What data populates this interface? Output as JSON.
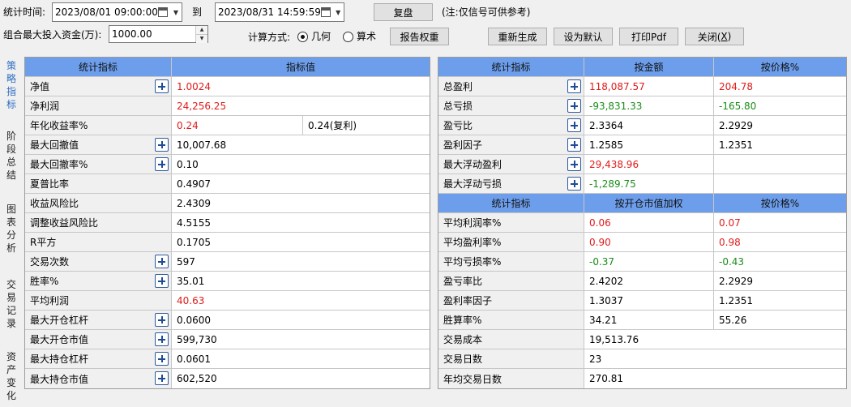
{
  "toolbar": {
    "stat_time_label": "统计时间:",
    "start_datetime": "2023/08/01 09:00:00",
    "to_label": "到",
    "end_datetime": "2023/08/31 14:59:59",
    "replay_button": "复盘",
    "note": "(注:仅信号可供参考)",
    "max_capital_label": "组合最大投入资金(万):",
    "max_capital_value": "1000.00",
    "calc_method_label": "计算方式:",
    "geometric_label": "几何",
    "arithmetic_label": "算术",
    "calc_method_selected": "几何",
    "report_weight_button": "报告权重",
    "regenerate_button": "重新生成",
    "set_default_button": "设为默认",
    "print_pdf_button": "打印Pdf",
    "close_button_text": "关闭(",
    "close_button_key": "X",
    "close_button_end": ")"
  },
  "side_tabs": [
    {
      "label": "策略指标",
      "active": true
    },
    {
      "label": "阶段总结",
      "active": false
    },
    {
      "label": "图表分析",
      "active": false
    },
    {
      "label": "交易记录",
      "active": false
    },
    {
      "label": "资产变化",
      "active": false
    }
  ],
  "left_table": {
    "headers": [
      "统计指标",
      "指标值"
    ],
    "rows": [
      {
        "name": "净值",
        "value": "1.0024",
        "color": "pos",
        "expand": true
      },
      {
        "name": "净利润",
        "value": "24,256.25",
        "color": "pos",
        "expand": false
      },
      {
        "name": "年化收益率%",
        "value": "0.24",
        "value2": "0.24(复利)",
        "color": "pos",
        "expand": false
      },
      {
        "name": "最大回撤值",
        "value": "10,007.68",
        "color": "",
        "expand": true
      },
      {
        "name": "最大回撤率%",
        "value": "0.10",
        "color": "",
        "expand": true
      },
      {
        "name": "夏普比率",
        "value": "0.4907",
        "color": "",
        "expand": false
      },
      {
        "name": "收益风险比",
        "value": "2.4309",
        "color": "",
        "expand": false
      },
      {
        "name": "调整收益风险比",
        "value": "4.5155",
        "color": "",
        "expand": false
      },
      {
        "name": "R平方",
        "value": "0.1705",
        "color": "",
        "expand": false
      },
      {
        "name": "交易次数",
        "value": "597",
        "color": "",
        "expand": true
      },
      {
        "name": "胜率%",
        "value": "35.01",
        "color": "",
        "expand": true
      },
      {
        "name": "平均利润",
        "value": "40.63",
        "color": "pos",
        "expand": false
      },
      {
        "name": "最大开仓杠杆",
        "value": "0.0600",
        "color": "",
        "expand": true
      },
      {
        "name": "最大开仓市值",
        "value": "599,730",
        "color": "",
        "expand": true
      },
      {
        "name": "最大持仓杠杆",
        "value": "0.0601",
        "color": "",
        "expand": true
      },
      {
        "name": "最大持仓市值",
        "value": "602,520",
        "color": "",
        "expand": true
      }
    ]
  },
  "right_table_top": {
    "headers": [
      "统计指标",
      "按金额",
      "按价格%"
    ],
    "rows": [
      {
        "name": "总盈利",
        "v1": "118,087.57",
        "c1": "pos",
        "v2": "204.78",
        "c2": "pos",
        "expand": true
      },
      {
        "name": "总亏损",
        "v1": "-93,831.33",
        "c1": "neg",
        "v2": "-165.80",
        "c2": "neg",
        "expand": true
      },
      {
        "name": "盈亏比",
        "v1": "2.3364",
        "c1": "",
        "v2": "2.2929",
        "c2": "",
        "expand": true
      },
      {
        "name": "盈利因子",
        "v1": "1.2585",
        "c1": "",
        "v2": "1.2351",
        "c2": "",
        "expand": true
      },
      {
        "name": "最大浮动盈利",
        "v1": "29,438.96",
        "c1": "pos",
        "expand": true
      },
      {
        "name": "最大浮动亏损",
        "v1": "-1,289.75",
        "c1": "neg",
        "expand": true
      }
    ]
  },
  "right_table_bottom": {
    "headers": [
      "统计指标",
      "按开仓市值加权",
      "按价格%"
    ],
    "rows": [
      {
        "name": "平均利润率%",
        "v1": "0.06",
        "c1": "pos",
        "v2": "0.07",
        "c2": "pos"
      },
      {
        "name": "平均盈利率%",
        "v1": "0.90",
        "c1": "pos",
        "v2": "0.98",
        "c2": "pos"
      },
      {
        "name": "平均亏损率%",
        "v1": "-0.37",
        "c1": "neg",
        "v2": "-0.43",
        "c2": "neg"
      },
      {
        "name": "盈亏率比",
        "v1": "2.4202",
        "c1": "",
        "v2": "2.2929",
        "c2": ""
      },
      {
        "name": "盈利率因子",
        "v1": "1.3037",
        "c1": "",
        "v2": "1.2351",
        "c2": ""
      },
      {
        "name": "胜算率%",
        "v1": "34.21",
        "c1": "",
        "v2": "55.26",
        "c2": ""
      },
      {
        "name": "交易成本",
        "v1": "19,513.76",
        "c1": "",
        "span": true
      },
      {
        "name": "交易日数",
        "v1": "23",
        "c1": "",
        "span": true
      },
      {
        "name": "年均交易日数",
        "v1": "270.81",
        "c1": "",
        "span": true
      }
    ]
  },
  "colors": {
    "header_bg": "#6d9eeb",
    "positive": "#e01b1b",
    "negative": "#1a8c1a",
    "active_tab": "#2f6ec2"
  }
}
